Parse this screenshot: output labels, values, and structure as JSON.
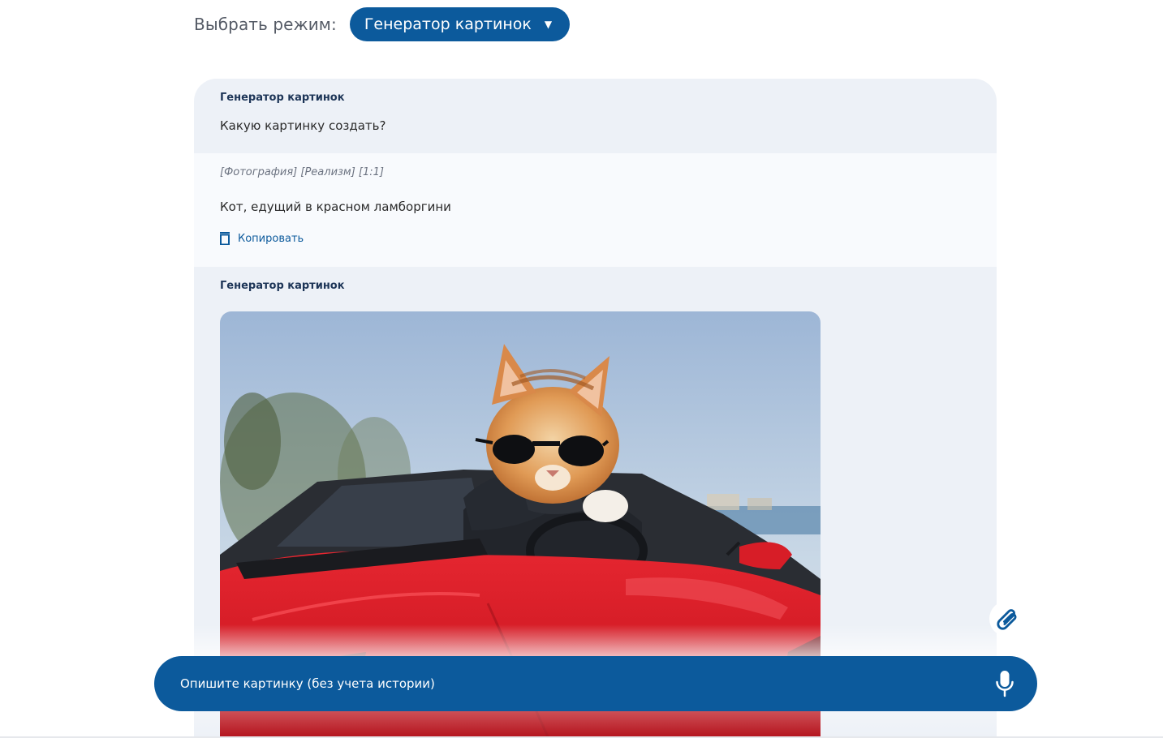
{
  "mode": {
    "label": "Выбрать режим:",
    "selected": "Генератор картинок"
  },
  "messages": [
    {
      "role": "bot",
      "sender": "Генератор картинок",
      "text": "Какую картинку создать?"
    },
    {
      "role": "user",
      "tags": "[Фотография] [Реализм] [1:1]",
      "text": "Кот, едущий в красном ламборгини",
      "copy_label": "Копировать"
    },
    {
      "role": "bot",
      "sender": "Генератор картинок",
      "image_alt": "cat-in-red-lamborghini"
    }
  ],
  "composer": {
    "placeholder": "Опишите картинку (без учета истории)",
    "mic_icon": "microphone-icon",
    "attach_icon": "paperclip-icon"
  },
  "colors": {
    "accent": "#0c5a9c",
    "bot_bg": "#edf1f7",
    "user_bg": "#f8fafd"
  }
}
